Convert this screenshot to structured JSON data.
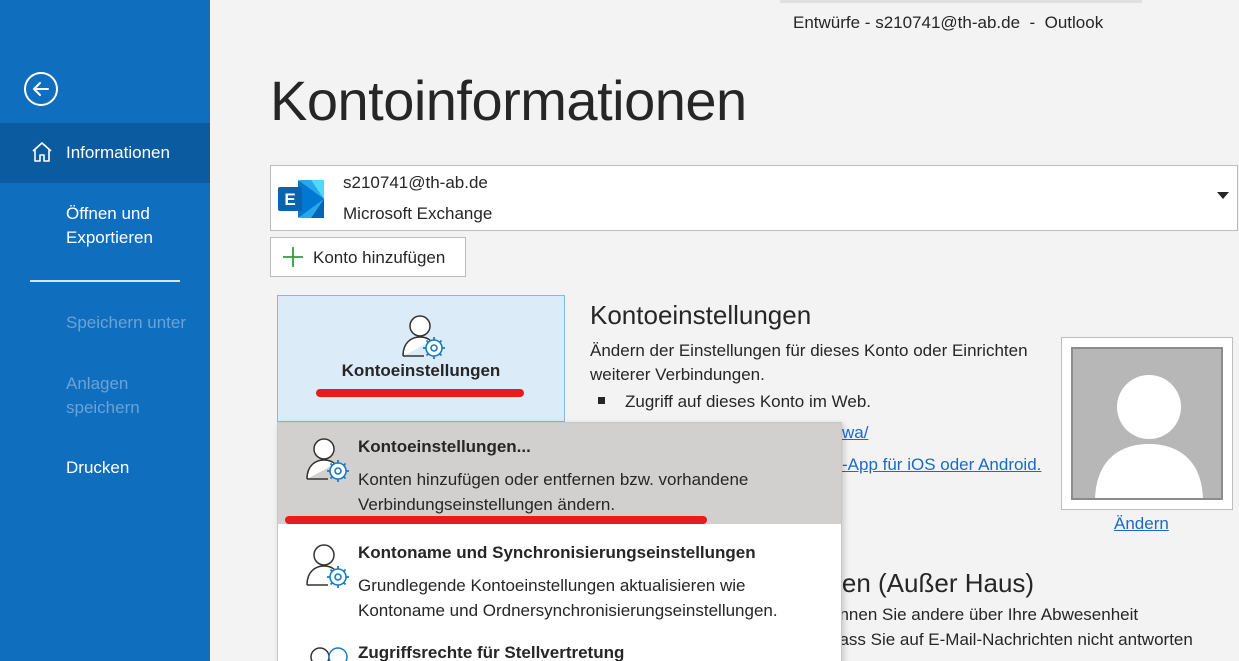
{
  "window": {
    "title": "Entwürfe - s210741@th-ab.de  -  Outlook"
  },
  "sidebar": {
    "back_icon": "back-arrow-icon",
    "items": [
      {
        "label": "Informationen",
        "icon": "home-icon",
        "active": true
      },
      {
        "label": "Öffnen und Exportieren"
      },
      {
        "label": "Speichern unter",
        "disabled": true
      },
      {
        "label": "Anlagen speichern",
        "disabled": true
      },
      {
        "label": "Drucken"
      }
    ]
  },
  "main": {
    "title": "Kontoinformationen",
    "account": {
      "email": "s210741@th-ab.de",
      "type": "Microsoft Exchange",
      "icon": "exchange-icon"
    },
    "add_account_label": "Konto hinzufügen",
    "account_settings": {
      "button_label": "Kontoeinstellungen",
      "heading": "Kontoeinstellungen",
      "description": "Ändern der Einstellungen für dieses Konto oder Einrichten weiterer Verbindungen.",
      "bullet": "Zugriff auf dieses Konto im Web.",
      "link_fragment1": "wa/",
      "link_fragment2": "-App für iOS oder Android."
    },
    "photo_change_label": "Ändern",
    "oof": {
      "title_fragment": "rten (Außer Haus)",
      "line1": "önnen Sie andere über Ihre Abwesenheit",
      "line2": "dass Sie auf E-Mail-Nachrichten nicht antworten"
    }
  },
  "menu": {
    "items": [
      {
        "title": "Kontoeinstellungen...",
        "description": "Konten hinzufügen oder entfernen bzw. vorhandene Verbindungseinstellungen ändern."
      },
      {
        "title": "Kontoname und Synchronisierungseinstellungen",
        "description": "Grundlegende Kontoeinstellungen aktualisieren wie Kontoname und Ordnersynchronisierungseinstellungen."
      },
      {
        "title": "Zugriffsrechte für Stellvertretung",
        "description": ""
      }
    ]
  },
  "colors": {
    "sidebar": "#106ebe",
    "sidebar_active": "#0b5ba0",
    "accent_link": "#1b6ac9",
    "highlight_red": "#e81c1c"
  }
}
